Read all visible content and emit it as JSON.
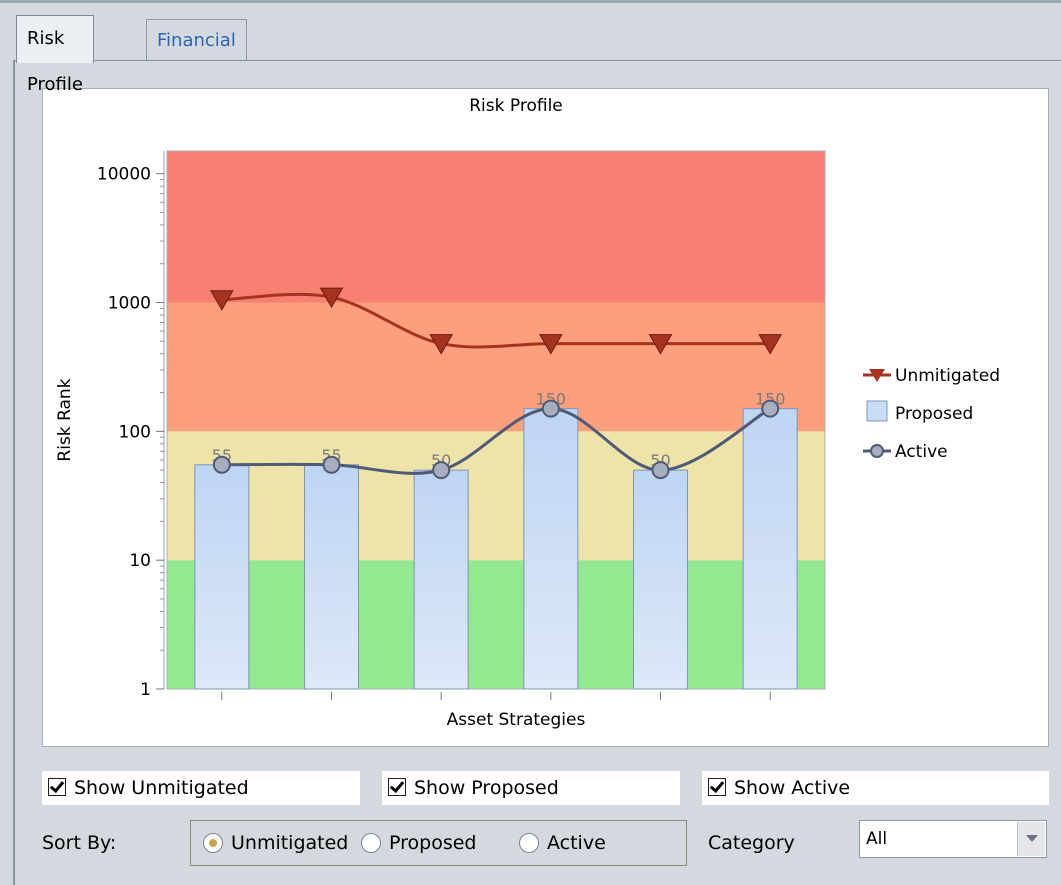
{
  "tabs": [
    {
      "label": "Risk Profile",
      "active": true
    },
    {
      "label": "Financial Risk",
      "active": false
    }
  ],
  "colors": {
    "band_high": "#f78072",
    "band_medium_high": "#fc9f7c",
    "band_medium": "#eee4aa",
    "band_low": "#94e88f",
    "unmitigated": "#a5331f",
    "proposed_fill": "#c8dcf5",
    "active_line": "#4e5a76",
    "active_marker": "#a7aebd"
  },
  "chart_data": {
    "type": "bar",
    "title": "Risk Profile",
    "xlabel": "Asset Strategies",
    "ylabel": "Risk Rank",
    "yscale": "log",
    "ylim": [
      1,
      15000
    ],
    "yticks": [
      "1",
      "10",
      "100",
      "1000",
      "10000"
    ],
    "categories": [
      "",
      "",
      "",
      "",
      "",
      ""
    ],
    "bands": [
      {
        "from": 1,
        "to": 10,
        "color": "#94e88f"
      },
      {
        "from": 10,
        "to": 100,
        "color": "#eee4aa"
      },
      {
        "from": 100,
        "to": 1000,
        "color": "#fc9f7c"
      },
      {
        "from": 1000,
        "to": 15000,
        "color": "#f78072"
      }
    ],
    "series": [
      {
        "name": "Unmitigated",
        "kind": "line",
        "marker": "triangle-down",
        "values": [
          1050,
          1100,
          480,
          480,
          480,
          480
        ]
      },
      {
        "name": "Proposed",
        "kind": "bar",
        "values": [
          55,
          55,
          50,
          150,
          50,
          150
        ],
        "data_labels": [
          "55",
          "55",
          "50",
          "150",
          "50",
          "150"
        ]
      },
      {
        "name": "Active",
        "kind": "line",
        "marker": "circle",
        "values": [
          55,
          55,
          50,
          150,
          50,
          150
        ]
      }
    ],
    "legend": [
      "Unmitigated",
      "Proposed",
      "Active"
    ],
    "legend_position": "right",
    "grid": false
  },
  "controls": {
    "show_unmitigated": {
      "label": "Show Unmitigated",
      "checked": true
    },
    "show_proposed": {
      "label": "Show Proposed",
      "checked": true
    },
    "show_active": {
      "label": "Show Active",
      "checked": true
    },
    "sort_by_label": "Sort By:",
    "sort_options": [
      {
        "label": "Unmitigated",
        "selected": true
      },
      {
        "label": "Proposed",
        "selected": false
      },
      {
        "label": "Active",
        "selected": false
      }
    ],
    "category_label": "Category",
    "category_value": "All"
  }
}
